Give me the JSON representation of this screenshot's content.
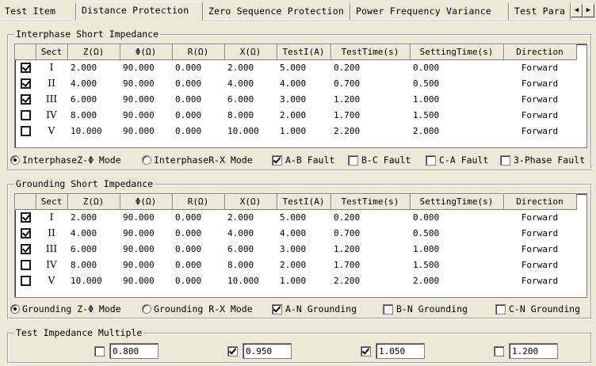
{
  "tabs": [
    {
      "label": "Test Item",
      "active": false
    },
    {
      "label": "Distance Protection",
      "active": true
    },
    {
      "label": "Zero Sequence Protection",
      "active": false
    },
    {
      "label": "Power Frequency Variance",
      "active": false
    },
    {
      "label": "Test Para",
      "active": false
    }
  ],
  "tab_scroll": {
    "left": "◀",
    "right": "▶"
  },
  "columns": [
    "",
    "Sect",
    "Z(Ω)",
    "Φ(Ω)",
    "R(Ω)",
    "X(Ω)",
    "TestI(A)",
    "TestTime(s)",
    "SettingTime(s)",
    "Direction"
  ],
  "interphase": {
    "title": "Interphase Short Impedance",
    "rows": [
      {
        "checked": true,
        "sect": "I",
        "z": "2.000",
        "phi": "90.000",
        "r": "0.000",
        "x": "2.000",
        "i": "5.000",
        "t": "0.200",
        "st": "0.000",
        "dir": "Forward"
      },
      {
        "checked": true,
        "sect": "II",
        "z": "4.000",
        "phi": "90.000",
        "r": "0.000",
        "x": "4.000",
        "i": "4.000",
        "t": "0.700",
        "st": "0.500",
        "dir": "Forward"
      },
      {
        "checked": true,
        "sect": "III",
        "z": "6.000",
        "phi": "90.000",
        "r": "0.000",
        "x": "6.000",
        "i": "3.000",
        "t": "1.200",
        "st": "1.000",
        "dir": "Forward"
      },
      {
        "checked": false,
        "sect": "IV",
        "z": "8.000",
        "phi": "90.000",
        "r": "0.000",
        "x": "8.000",
        "i": "2.000",
        "t": "1.700",
        "st": "1.500",
        "dir": "Forward"
      },
      {
        "checked": false,
        "sect": "V",
        "z": "10.000",
        "phi": "90.000",
        "r": "0.000",
        "x": "10.000",
        "i": "1.000",
        "t": "2.200",
        "st": "2.000",
        "dir": "Forward"
      }
    ],
    "options": {
      "mode_zphi": "InterphaseZ-Φ Mode",
      "mode_rx": "InterphaseR-X Mode",
      "ab": "A-B Fault",
      "bc": "B-C Fault",
      "ca": "C-A Fault",
      "three": "3-Phase Fault"
    }
  },
  "grounding": {
    "title": "Grounding Short Impedance",
    "rows": [
      {
        "checked": true,
        "sect": "I",
        "z": "2.000",
        "phi": "90.000",
        "r": "0.000",
        "x": "2.000",
        "i": "5.000",
        "t": "0.200",
        "st": "0.000",
        "dir": "Forward"
      },
      {
        "checked": true,
        "sect": "II",
        "z": "4.000",
        "phi": "90.000",
        "r": "0.000",
        "x": "4.000",
        "i": "4.000",
        "t": "0.700",
        "st": "0.500",
        "dir": "Forward"
      },
      {
        "checked": true,
        "sect": "III",
        "z": "6.000",
        "phi": "90.000",
        "r": "0.000",
        "x": "6.000",
        "i": "3.000",
        "t": "1.200",
        "st": "1.000",
        "dir": "Forward"
      },
      {
        "checked": false,
        "sect": "IV",
        "z": "8.000",
        "phi": "90.000",
        "r": "0.000",
        "x": "8.000",
        "i": "2.000",
        "t": "1.700",
        "st": "1.500",
        "dir": "Forward"
      },
      {
        "checked": false,
        "sect": "V",
        "z": "10.000",
        "phi": "90.000",
        "r": "0.000",
        "x": "10.000",
        "i": "1.000",
        "t": "2.200",
        "st": "2.000",
        "dir": "Forward"
      }
    ],
    "options": {
      "mode_zphi": "Grounding Z-Φ Mode",
      "mode_rx": "Grounding R-X Mode",
      "an": "A-N Grounding",
      "bn": "B-N Grounding",
      "cn": "C-N Grounding"
    }
  },
  "multiple": {
    "title": "Test Impedance Multiple",
    "items": [
      {
        "checked": false,
        "value": "0.800"
      },
      {
        "checked": true,
        "value": "0.950"
      },
      {
        "checked": true,
        "value": "1.050"
      },
      {
        "checked": false,
        "value": "1.200"
      }
    ]
  }
}
